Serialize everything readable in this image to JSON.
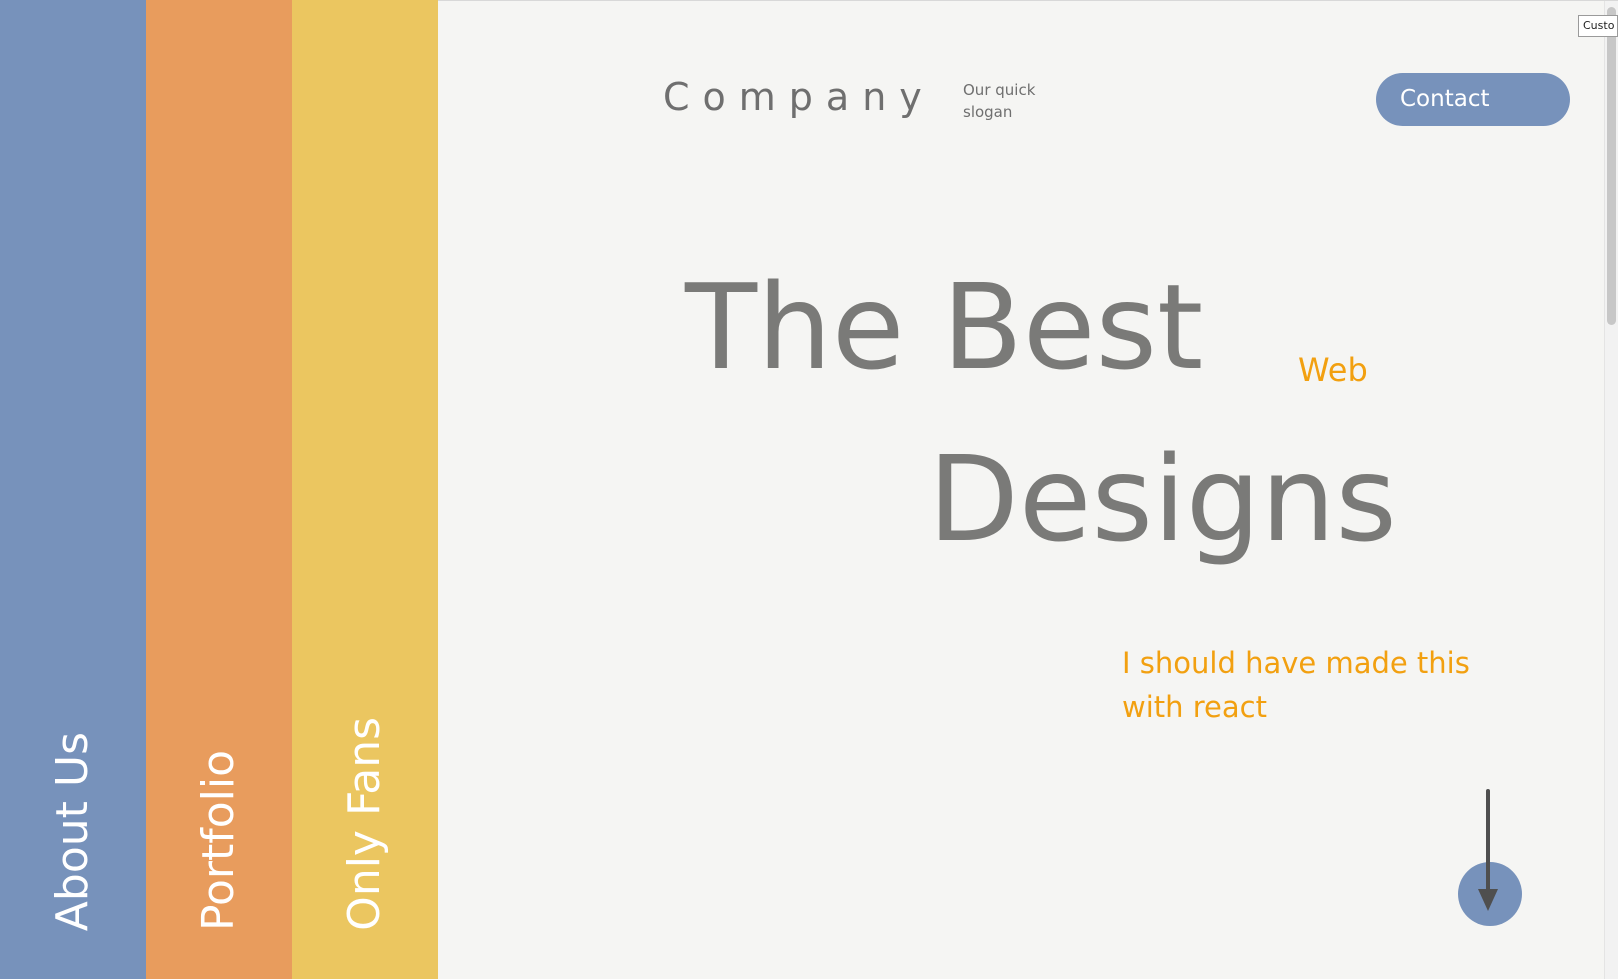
{
  "nav": {
    "items": [
      {
        "label": "About Us",
        "color": "#7792bb"
      },
      {
        "label": "Portfolio",
        "color": "#e89c5d"
      },
      {
        "label": "Only Fans",
        "color": "#ebc660"
      }
    ]
  },
  "header": {
    "brand": "Company",
    "slogan": "Our quick slogan",
    "contact_label": "Contact"
  },
  "hero": {
    "line1": "The Best",
    "accent": "Web",
    "line2": "Designs",
    "tagline": "I should have made this with react"
  },
  "scroll_button": {
    "icon": "arrow-down-icon"
  },
  "tooltip": {
    "text": "Custo"
  },
  "colors": {
    "background": "#f5f5f3",
    "text_gray": "#7a7a78",
    "accent_orange": "#f2a010",
    "button_blue": "#7792bb"
  }
}
